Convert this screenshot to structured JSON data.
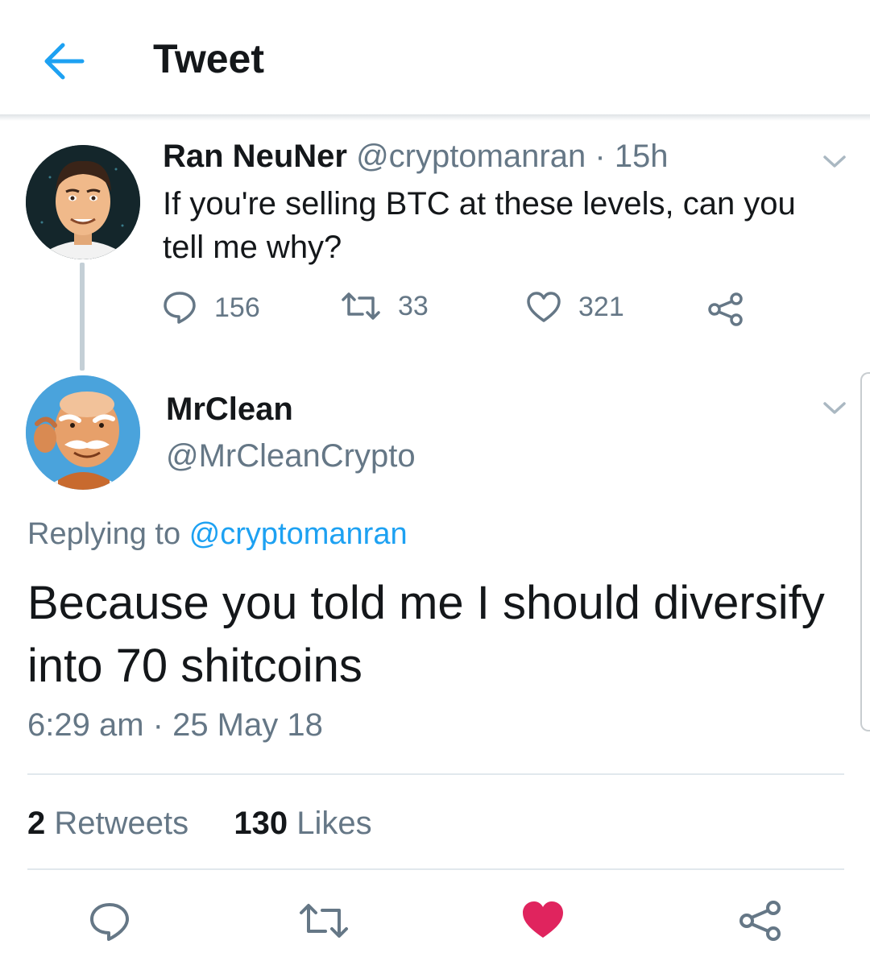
{
  "header": {
    "title": "Tweet",
    "back_icon": "arrow-left-icon",
    "accent": "#1da1f2"
  },
  "parent_tweet": {
    "author_name": "Ran NeuNer",
    "handle": "@cryptomanran",
    "separator": "·",
    "time": "15h",
    "text": "If you're selling BTC at these levels, can you tell me why?",
    "replies": "156",
    "retweets": "33",
    "likes": "321",
    "icons": [
      "reply-icon",
      "retweet-icon",
      "like-icon",
      "share-icon",
      "chevron-down-icon"
    ]
  },
  "reply_tweet": {
    "author_name": "MrClean",
    "handle": "@MrCleanCrypto",
    "replying_label": "Replying to",
    "replying_handle": "@cryptomanran",
    "text": "Because you told me I should diversify into 70 shitcoins",
    "timestamp": "6:29 am · 25 May 18"
  },
  "stats": {
    "retweets_count": "2",
    "retweets_label": "Retweets",
    "likes_count": "130",
    "likes_label": "Likes"
  },
  "action_bar": {
    "icons": [
      "reply-icon",
      "retweet-icon",
      "like-icon-filled",
      "share-icon"
    ],
    "liked_color": "#e0245e"
  },
  "colors": {
    "text": "#14171a",
    "muted": "#657786",
    "link": "#1da1f2",
    "divider": "#e1e8ed"
  }
}
